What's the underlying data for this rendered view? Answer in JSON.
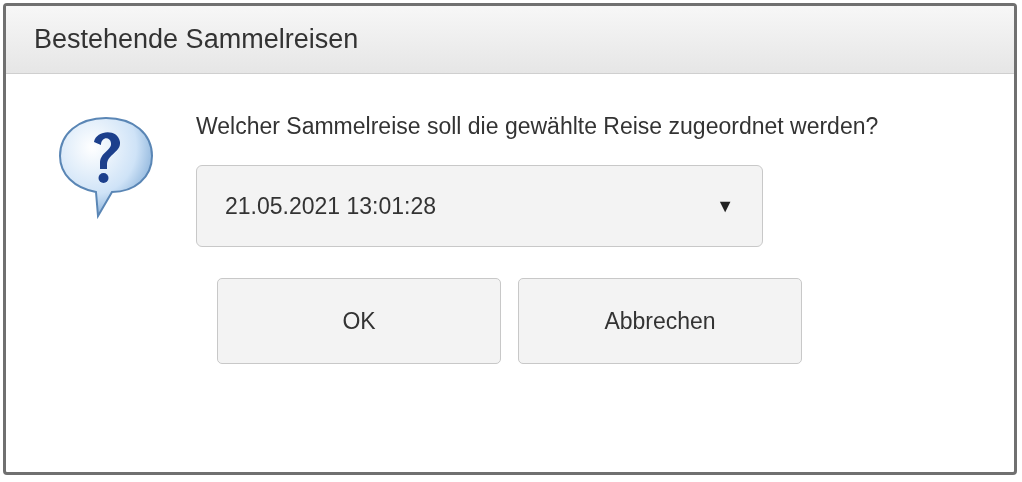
{
  "window": {
    "title": "Bestehende Sammelreisen"
  },
  "message": "Welcher Sammelreise soll die gewählte Reise zugeordnet werden?",
  "dropdown": {
    "value": "21.05.2021 13:01:28",
    "caret": "▼"
  },
  "buttons": [
    {
      "label": "OK"
    },
    {
      "label": "Abbrechen"
    }
  ]
}
